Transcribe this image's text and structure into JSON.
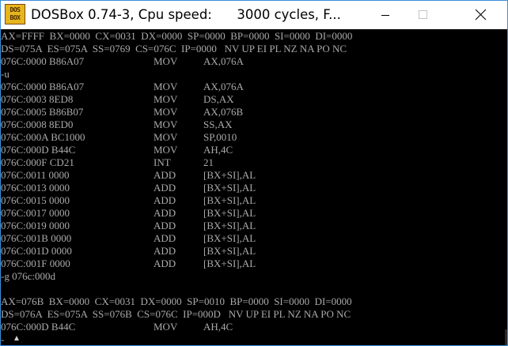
{
  "window": {
    "title": "DOSBox 0.74-3, Cpu speed:      3000 cycles, F...",
    "icon_line1": "DOS",
    "icon_line2": "BOX",
    "icon_name": "dosbox-app-icon",
    "controls": [
      "minimize-icon",
      "maximize-icon",
      "close-icon"
    ],
    "colors": {
      "border": "#3c8fdc",
      "console_bg": "#000000",
      "console_fg": "#aaaaaa",
      "icon": "#e7b51d"
    }
  },
  "regs1": {
    "a": "AX=FFFF  BX=0000  CX=0031  DX=0000  SP=0000  BP=0000  SI=0000  DI=0000",
    "b": "DS=075A  ES=075A  SS=0769  CS=076C  IP=0000   NV UP EI PL NZ NA PO NC",
    "ins": {
      "addr": "076C:0000 B86A07",
      "op": "MOV",
      "arg": "AX,076A"
    }
  },
  "cmd_u": "-u",
  "disasm": [
    {
      "addr": "076C:0000 B86A07",
      "op": "MOV",
      "arg": "AX,076A"
    },
    {
      "addr": "076C:0003 8ED8",
      "op": "MOV",
      "arg": "DS,AX"
    },
    {
      "addr": "076C:0005 B86B07",
      "op": "MOV",
      "arg": "AX,076B"
    },
    {
      "addr": "076C:0008 8ED0",
      "op": "MOV",
      "arg": "SS,AX"
    },
    {
      "addr": "076C:000A BC1000",
      "op": "MOV",
      "arg": "SP,0010"
    },
    {
      "addr": "076C:000D B44C",
      "op": "MOV",
      "arg": "AH,4C"
    },
    {
      "addr": "076C:000F CD21",
      "op": "INT",
      "arg": "21"
    },
    {
      "addr": "076C:0011 0000",
      "op": "ADD",
      "arg": "[BX+SI],AL"
    },
    {
      "addr": "076C:0013 0000",
      "op": "ADD",
      "arg": "[BX+SI],AL"
    },
    {
      "addr": "076C:0015 0000",
      "op": "ADD",
      "arg": "[BX+SI],AL"
    },
    {
      "addr": "076C:0017 0000",
      "op": "ADD",
      "arg": "[BX+SI],AL"
    },
    {
      "addr": "076C:0019 0000",
      "op": "ADD",
      "arg": "[BX+SI],AL"
    },
    {
      "addr": "076C:001B 0000",
      "op": "ADD",
      "arg": "[BX+SI],AL"
    },
    {
      "addr": "076C:001D 0000",
      "op": "ADD",
      "arg": "[BX+SI],AL"
    },
    {
      "addr": "076C:001F 0000",
      "op": "ADD",
      "arg": "[BX+SI],AL"
    }
  ],
  "cmd_g": "-g 076c:000d",
  "regs2": {
    "a": "AX=076B  BX=0000  CX=0031  DX=0000  SP=0010  BP=0000  SI=0000  DI=0000",
    "b": "DS=076A  ES=075A  SS=076B  CS=076C  IP=000D   NV UP EI PL NZ NA PO NC",
    "ins": {
      "addr": "076C:000D B44C",
      "op": "MOV",
      "arg": "AH,4C"
    }
  },
  "prompt": "-",
  "cursor_icon": "mouse-cursor-icon"
}
